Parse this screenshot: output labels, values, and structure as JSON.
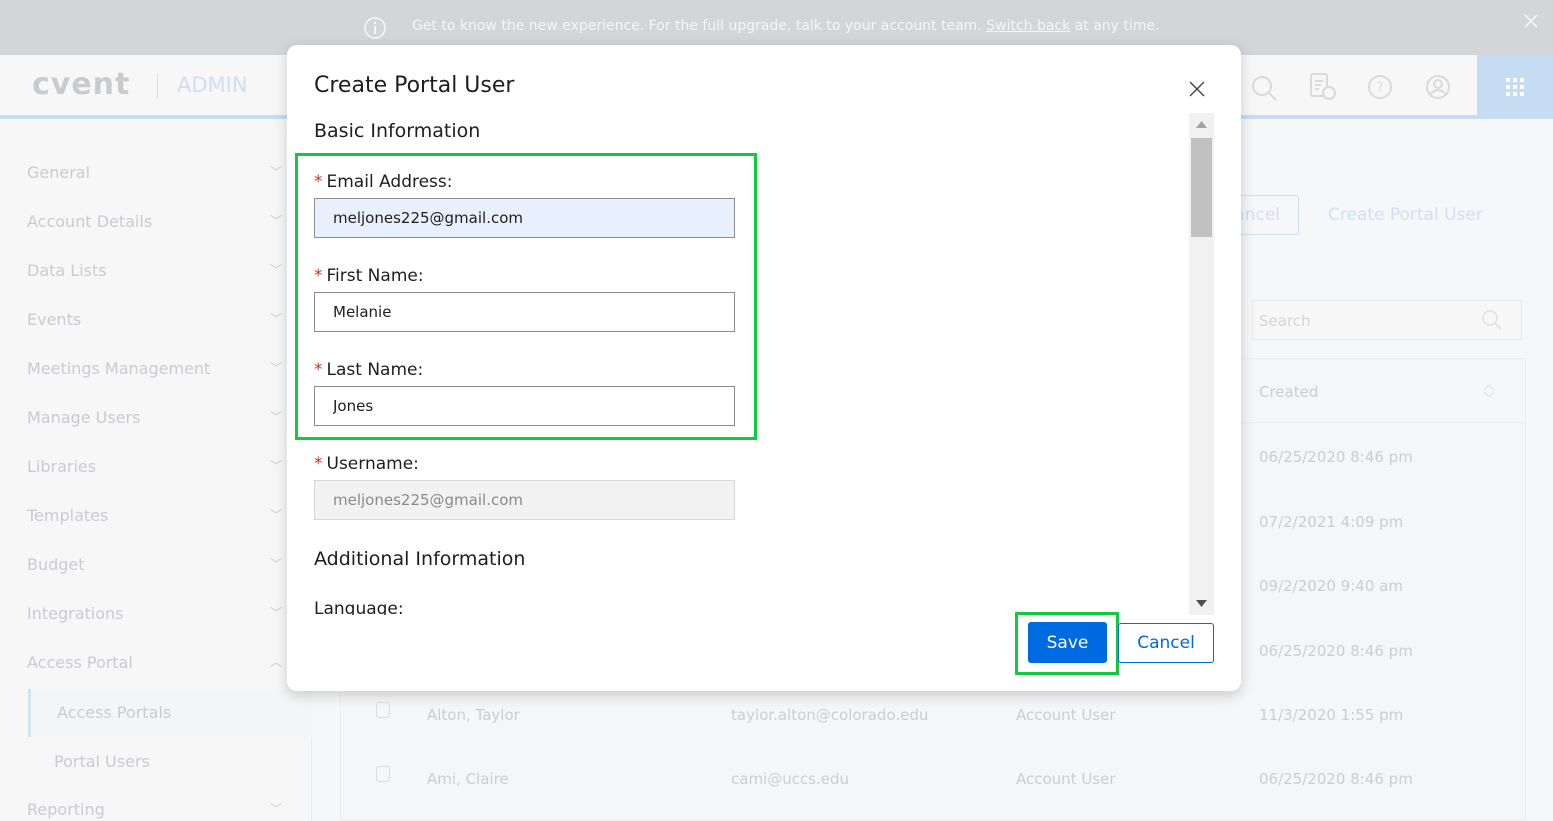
{
  "banner": {
    "text": "Get to know the new experience. For the full upgrade, talk to your account team.",
    "link": "Switch back",
    "suffix": "at any time.",
    "icons": [
      "info-icon",
      "close-icon"
    ]
  },
  "header": {
    "logo": "cvent",
    "section": "ADMIN",
    "icons": [
      "search-icon",
      "report-clock-icon",
      "help-icon",
      "user-icon",
      "apps-grid-icon"
    ]
  },
  "sidebar": {
    "items": [
      {
        "label": "General"
      },
      {
        "label": "Account Details"
      },
      {
        "label": "Data Lists"
      },
      {
        "label": "Events"
      },
      {
        "label": "Meetings Management"
      },
      {
        "label": "Manage Users"
      },
      {
        "label": "Libraries"
      },
      {
        "label": "Templates"
      },
      {
        "label": "Budget"
      },
      {
        "label": "Integrations"
      },
      {
        "label": "Access Portal",
        "expanded": true
      },
      {
        "label": "Reporting"
      }
    ],
    "sub_items": [
      {
        "label": "Access Portals",
        "active": true
      },
      {
        "label": "Portal Users"
      }
    ]
  },
  "page": {
    "cancel_label": "Cancel",
    "create_label": "Create Portal User",
    "search_placeholder": "Search",
    "table": {
      "header_created": "Created",
      "created_values": [
        "06/25/2020 8:46 pm",
        "07/2/2021 4:09 pm",
        "09/2/2020 9:40 am",
        "06/25/2020 8:46 pm"
      ],
      "rows": [
        {
          "name": "Alton, Taylor",
          "email": "taylor.alton@colorado.edu",
          "type": "Account User",
          "created": "11/3/2020 1:55 pm"
        },
        {
          "name": "Ami, Claire",
          "email": "cami@uccs.edu",
          "type": "Account User",
          "created": "06/25/2020 8:46 pm"
        }
      ]
    }
  },
  "modal": {
    "title": "Create Portal User",
    "section_basic": "Basic Information",
    "section_additional": "Additional Information",
    "email_label": "Email Address:",
    "email_value": "meljones225@gmail.com",
    "first_label": "First Name:",
    "first_value": "Melanie",
    "last_label": "Last Name:",
    "last_value": "Jones",
    "username_label": "Username:",
    "username_value": "meljones225@gmail.com",
    "language_label": "Language:",
    "required_mark": "*",
    "save_label": "Save",
    "cancel_label": "Cancel",
    "scroll_position": 0
  },
  "colors": {
    "primary": "#006ae1",
    "highlight": "#13c940",
    "required": "#d0361e"
  }
}
